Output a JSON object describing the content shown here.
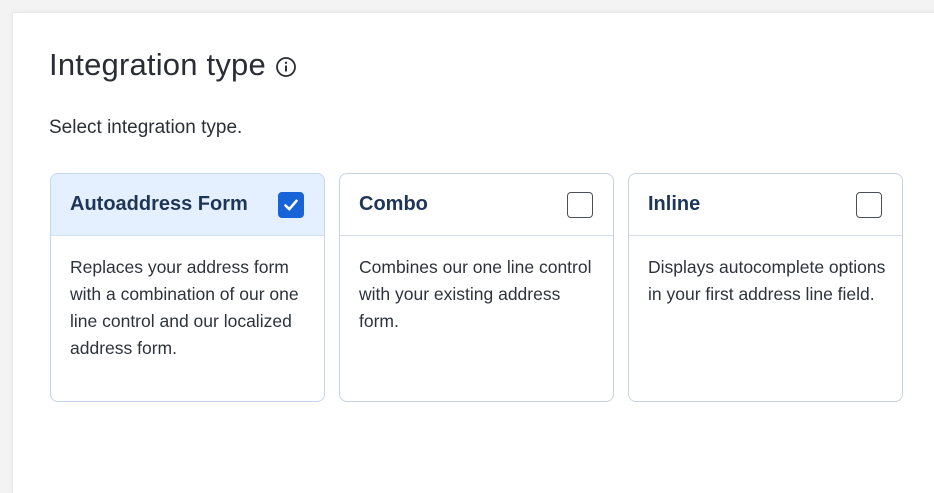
{
  "section": {
    "title": "Integration type",
    "info_icon": "info-circle-icon",
    "subtitle": "Select integration type."
  },
  "colors": {
    "selected_header_bg": "#e4efff",
    "checkbox_checked": "#1763d8",
    "card_title": "#1e3656"
  },
  "cards": [
    {
      "title": "Autoaddress Form",
      "checked": true,
      "description": "Replaces your address form with a combination of our one line control and our localized address form."
    },
    {
      "title": "Combo",
      "checked": false,
      "description": "Combines our one line control with your existing address form."
    },
    {
      "title": "Inline",
      "checked": false,
      "description": "Displays autocomplete options in your first address line field."
    }
  ]
}
